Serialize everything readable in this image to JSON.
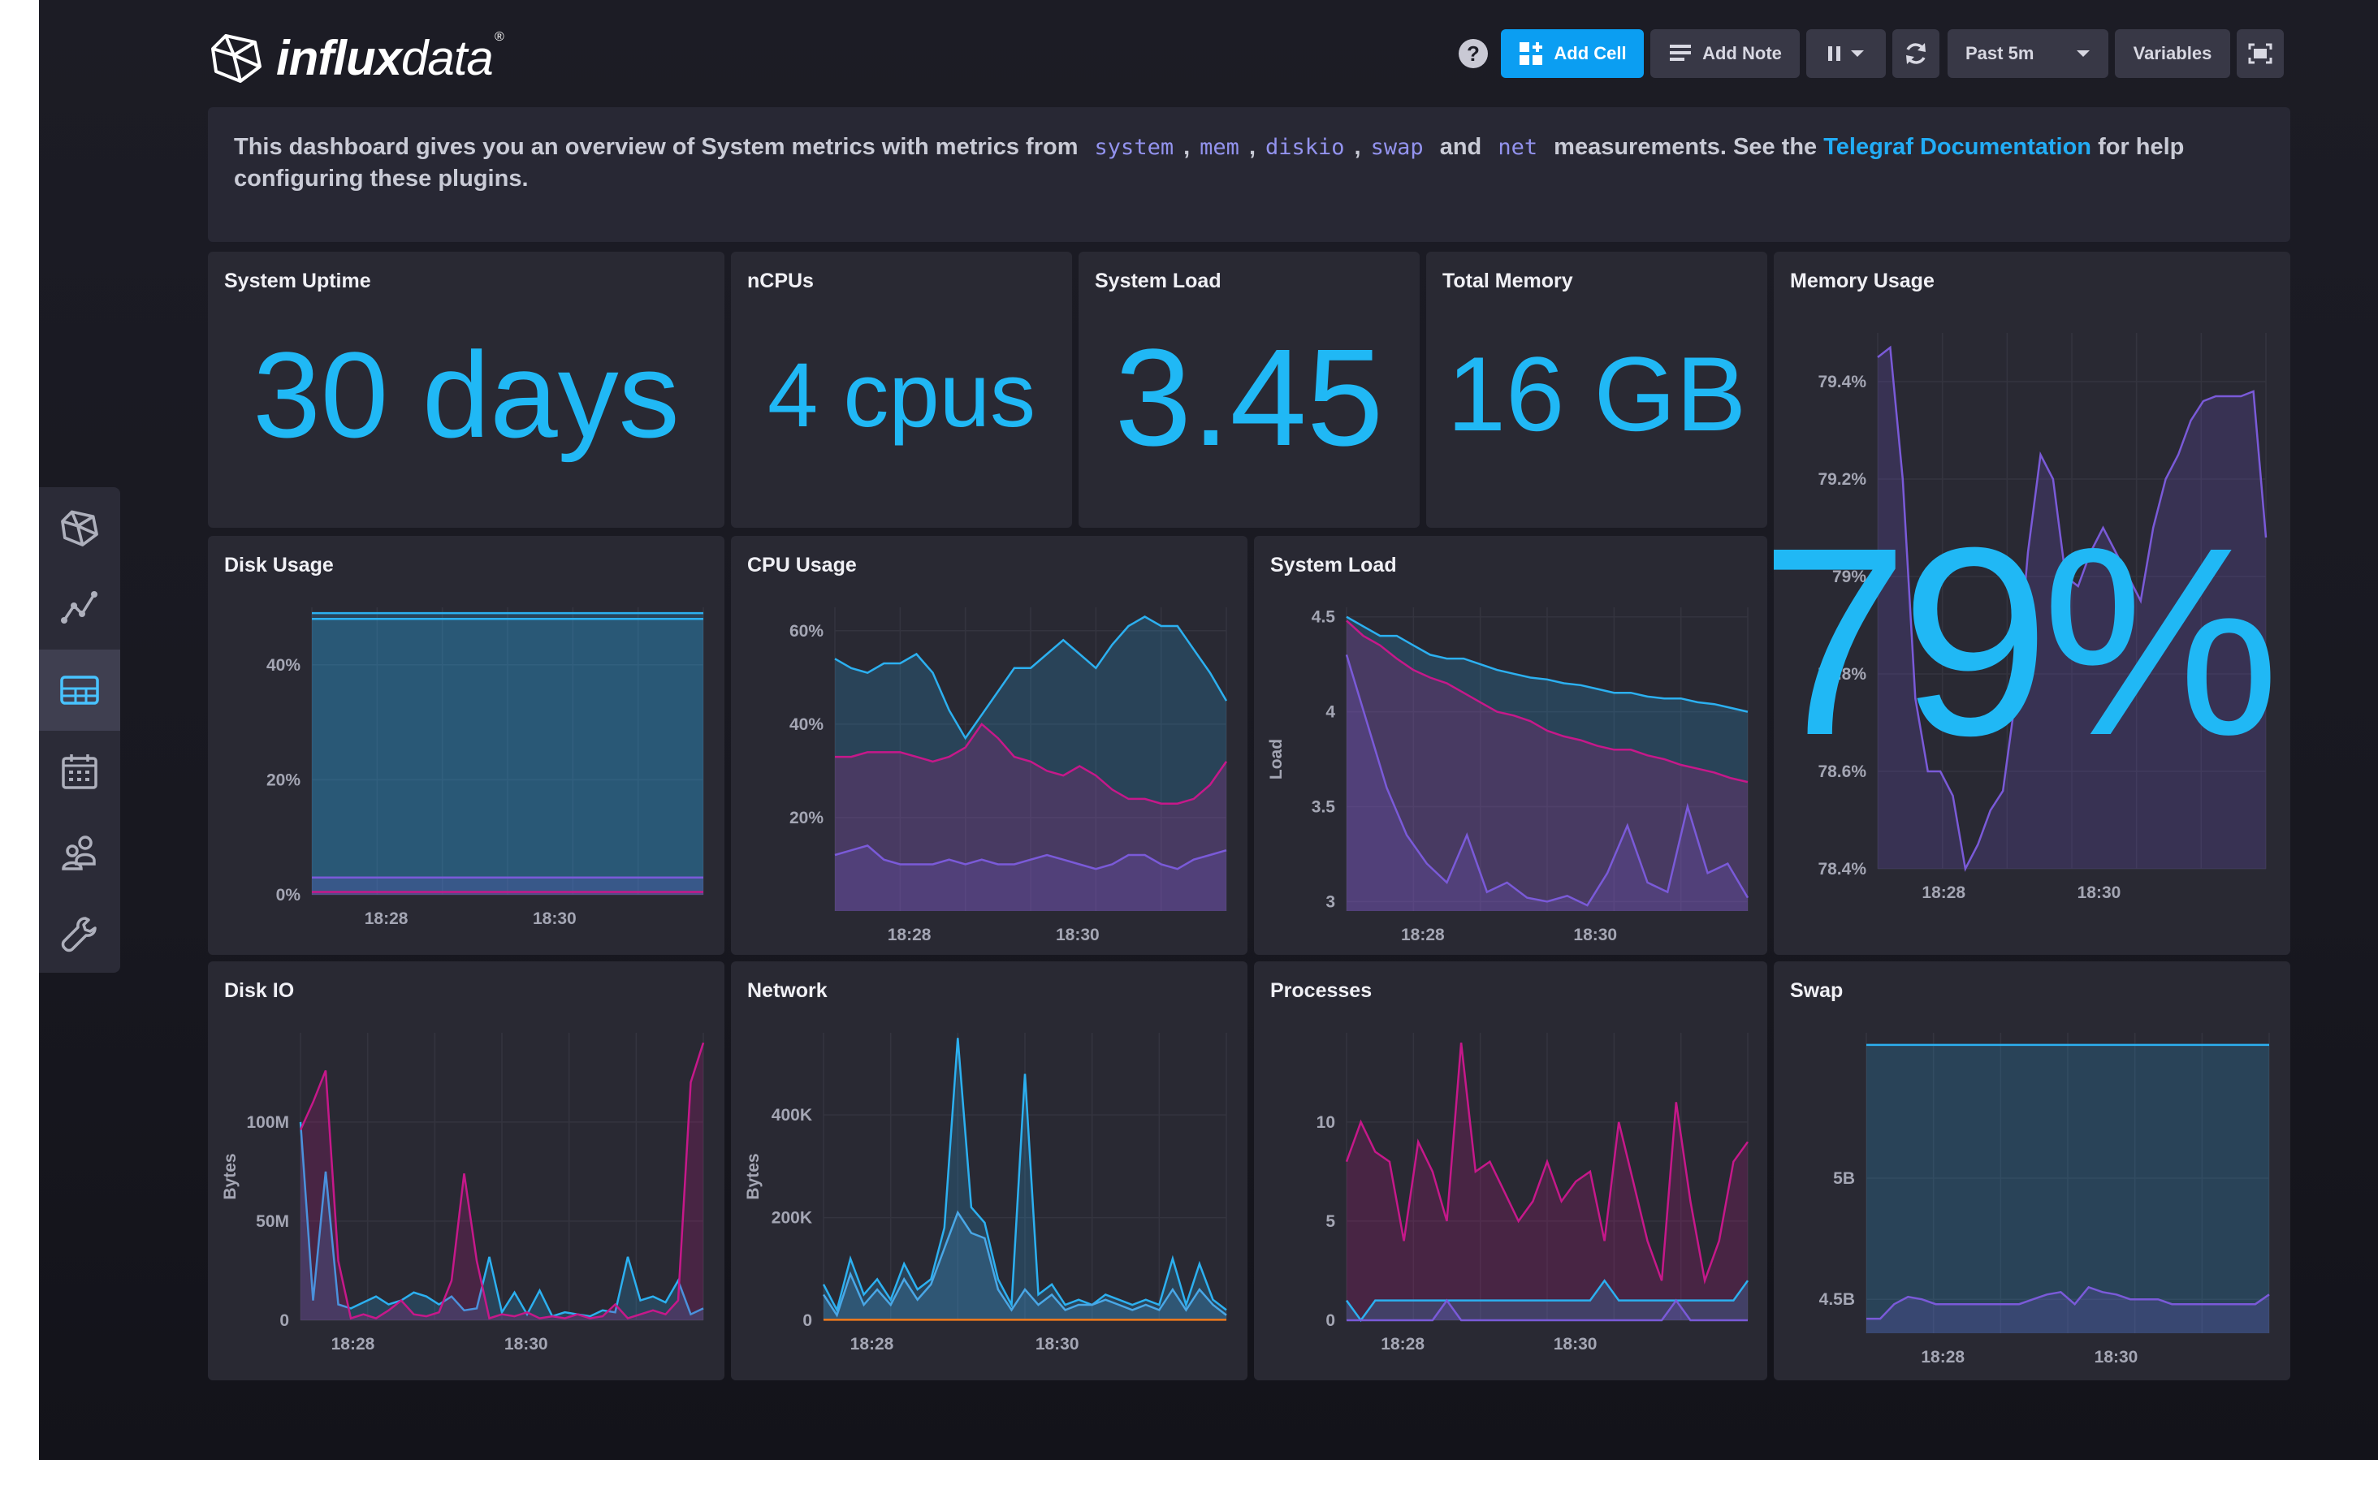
{
  "header": {
    "logo_bold": "influx",
    "logo_light": "data",
    "logo_mark": "®",
    "help_label": "?",
    "add_cell": "Add Cell",
    "add_note": "Add Note",
    "pause_icon": "pause-icon",
    "time_range": "Past 5m",
    "variables": "Variables"
  },
  "sidebar": {
    "items": [
      {
        "name": "logo",
        "icon": "influx-logo-icon"
      },
      {
        "name": "data-explorer",
        "icon": "graph-icon"
      },
      {
        "name": "dashboards",
        "icon": "dashboard-grid-icon",
        "active": true
      },
      {
        "name": "tasks",
        "icon": "calendar-icon"
      },
      {
        "name": "organizations",
        "icon": "users-icon"
      },
      {
        "name": "settings",
        "icon": "wrench-icon"
      }
    ]
  },
  "note": {
    "text_before": "This dashboard gives you an overview of System metrics with metrics from",
    "m1": "system",
    "m2": "mem",
    "m3": "diskio",
    "m4": "swap",
    "and": "and",
    "m5": "net",
    "text_after": "measurements. See the",
    "link": "Telegraf Documentation",
    "text_end": "for help configuring these plugins."
  },
  "cells": {
    "uptime": {
      "title": "System Uptime",
      "value": "30 days"
    },
    "ncpus": {
      "title": "nCPUs",
      "value": "4 cpus"
    },
    "load_stat": {
      "title": "System Load",
      "value": "3.45"
    },
    "memory_total": {
      "title": "Total Memory",
      "value": "16 GB"
    },
    "memory_usage": {
      "title": "Memory Usage",
      "value": "79%"
    },
    "disk_usage": {
      "title": "Disk Usage"
    },
    "cpu_usage": {
      "title": "CPU Usage"
    },
    "system_load": {
      "title": "System Load"
    },
    "disk_io": {
      "title": "Disk IO"
    },
    "network": {
      "title": "Network"
    },
    "processes": {
      "title": "Processes"
    },
    "swap": {
      "title": "Swap"
    }
  },
  "colors": {
    "accent": "#0b9ef2",
    "stat": "#20b8f5",
    "series_blue": "#2cb0f0",
    "series_magenta": "#c6188a",
    "series_purple": "#7a5ad8",
    "series_orange": "#f27a1a"
  },
  "chart_data": [
    {
      "id": "memory_usage",
      "type": "area",
      "title": "Memory Usage",
      "xlabel": "",
      "ylabel": "",
      "ylim": [
        78.4,
        79.5
      ],
      "yticks": [
        "79.4%",
        "79.2%",
        "79%",
        "78.8%",
        "78.6%",
        "78.4%"
      ],
      "ytick_values": [
        79.4,
        79.2,
        79.0,
        78.8,
        78.6,
        78.4
      ],
      "xticks": [
        "18:28",
        "18:30"
      ],
      "xtick_at": [
        0.17,
        0.57
      ],
      "series": [
        {
          "color": "#7a5ad8",
          "values": [
            79.45,
            79.47,
            79.2,
            78.75,
            78.6,
            78.6,
            78.55,
            78.4,
            78.45,
            78.52,
            78.56,
            78.75,
            79.05,
            79.25,
            79.2,
            79.0,
            78.98,
            79.05,
            79.1,
            79.05,
            79.0,
            78.95,
            79.1,
            79.2,
            79.25,
            79.32,
            79.36,
            79.37,
            79.37,
            79.37,
            79.38,
            79.08
          ]
        }
      ]
    },
    {
      "id": "disk_usage",
      "type": "area",
      "title": "Disk Usage",
      "ylim": [
        0,
        50
      ],
      "yticks": [
        "40%",
        "20%",
        "0%"
      ],
      "ytick_values": [
        40,
        20,
        0
      ],
      "xticks": [
        "18:28",
        "18:30"
      ],
      "xtick_at": [
        0.19,
        0.62
      ],
      "series": [
        {
          "color": "#2cb0f0",
          "values": [
            49,
            49
          ]
        },
        {
          "color": "#2cb0f0",
          "values": [
            48,
            48
          ]
        },
        {
          "color": "#7a5ad8",
          "values": [
            3,
            3
          ]
        },
        {
          "color": "#c6188a",
          "values": [
            0.5,
            0.5
          ]
        }
      ]
    },
    {
      "id": "cpu_usage",
      "type": "area",
      "title": "CPU Usage",
      "ylim": [
        0,
        65
      ],
      "yticks": [
        "60%",
        "40%",
        "20%"
      ],
      "ytick_values": [
        60,
        40,
        20
      ],
      "xticks": [
        "18:28",
        "18:30"
      ],
      "xtick_at": [
        0.19,
        0.62
      ],
      "series": [
        {
          "color": "#2cb0f0",
          "values": [
            54,
            52,
            51,
            53,
            53,
            55,
            51,
            43,
            37,
            42,
            47,
            52,
            52,
            55,
            58,
            55,
            52,
            57,
            61,
            63,
            61,
            61,
            56,
            51,
            45
          ]
        },
        {
          "color": "#c6188a",
          "values": [
            33,
            33,
            34,
            34,
            34,
            33,
            32,
            33,
            35,
            40,
            37,
            33,
            32,
            30,
            29,
            31,
            29,
            26,
            24,
            24,
            23,
            23,
            24,
            27,
            32
          ]
        },
        {
          "color": "#7a5ad8",
          "values": [
            12,
            13,
            14,
            11,
            10,
            10,
            10,
            11,
            10,
            11,
            10,
            10,
            11,
            12,
            11,
            10,
            9,
            10,
            12,
            12,
            10,
            9,
            11,
            12,
            13
          ]
        }
      ]
    },
    {
      "id": "system_load",
      "type": "area",
      "title": "System Load",
      "ylabel": "Load",
      "ylim": [
        2.95,
        4.55
      ],
      "yticks": [
        "4.5",
        "4",
        "3.5",
        "3"
      ],
      "ytick_values": [
        4.5,
        4,
        3.5,
        3
      ],
      "xticks": [
        "18:28",
        "18:30"
      ],
      "xtick_at": [
        0.19,
        0.62
      ],
      "series": [
        {
          "color": "#2cb0f0",
          "values": [
            4.5,
            4.45,
            4.4,
            4.4,
            4.35,
            4.3,
            4.28,
            4.28,
            4.25,
            4.22,
            4.2,
            4.18,
            4.17,
            4.15,
            4.14,
            4.12,
            4.1,
            4.1,
            4.08,
            4.07,
            4.07,
            4.05,
            4.04,
            4.02,
            4.0
          ]
        },
        {
          "color": "#c6188a",
          "values": [
            4.48,
            4.4,
            4.35,
            4.28,
            4.22,
            4.18,
            4.15,
            4.1,
            4.05,
            4.0,
            3.98,
            3.95,
            3.9,
            3.87,
            3.85,
            3.82,
            3.8,
            3.8,
            3.77,
            3.75,
            3.72,
            3.7,
            3.68,
            3.65,
            3.63
          ]
        },
        {
          "color": "#7a5ad8",
          "values": [
            4.3,
            3.95,
            3.6,
            3.35,
            3.2,
            3.1,
            3.35,
            3.05,
            3.1,
            3.02,
            3.0,
            3.03,
            2.98,
            3.15,
            3.4,
            3.1,
            3.05,
            3.5,
            3.15,
            3.2,
            3.02
          ]
        }
      ]
    },
    {
      "id": "disk_io",
      "type": "area",
      "title": "Disk IO",
      "ylabel": "Bytes",
      "ylim": [
        0,
        145000000
      ],
      "yticks": [
        "100M",
        "50M",
        "0"
      ],
      "ytick_values": [
        100000000,
        50000000,
        0
      ],
      "xticks": [
        "18:28",
        "18:30"
      ],
      "xtick_at": [
        0.13,
        0.56
      ],
      "series": [
        {
          "color": "#2cb0f0",
          "values": [
            100000000,
            10000000,
            75000000,
            8000000,
            6000000,
            9000000,
            12000000,
            8000000,
            10000000,
            14000000,
            12000000,
            8000000,
            12000000,
            5000000,
            6000000,
            32000000,
            4000000,
            14000000,
            3000000,
            15000000,
            2000000,
            4000000,
            3000000,
            2000000,
            5000000,
            4000000,
            32000000,
            10000000,
            12000000,
            9000000,
            20000000,
            3000000,
            6000000
          ]
        },
        {
          "color": "#c6188a",
          "values": [
            96000000,
            110000000,
            126000000,
            30000000,
            1000000,
            3000000,
            1000000,
            5000000,
            10000000,
            3000000,
            2000000,
            4000000,
            20000000,
            74000000,
            30000000,
            1000000,
            3000000,
            2000000,
            4000000,
            1000000,
            2000000,
            1000000,
            3000000,
            1000000,
            2000000,
            8000000,
            1000000,
            3000000,
            5000000,
            3000000,
            10000000,
            120000000,
            140000000
          ]
        }
      ]
    },
    {
      "id": "network",
      "type": "area",
      "title": "Network",
      "ylabel": "Bytes",
      "ylim": [
        0,
        560000
      ],
      "yticks": [
        "400K",
        "200K",
        "0"
      ],
      "ytick_values": [
        400000,
        200000,
        0
      ],
      "xticks": [
        "18:28",
        "18:30"
      ],
      "xtick_at": [
        0.12,
        0.58
      ],
      "series": [
        {
          "color": "#2cb0f0",
          "values": [
            70000,
            20000,
            120000,
            50000,
            80000,
            40000,
            110000,
            60000,
            80000,
            180000,
            550000,
            220000,
            190000,
            80000,
            30000,
            480000,
            50000,
            70000,
            30000,
            40000,
            30000,
            50000,
            40000,
            30000,
            40000,
            30000,
            120000,
            30000,
            110000,
            40000,
            20000
          ]
        },
        {
          "color": "#49a7e6",
          "values": [
            50000,
            10000,
            90000,
            30000,
            60000,
            30000,
            80000,
            40000,
            70000,
            140000,
            210000,
            170000,
            160000,
            60000,
            20000,
            60000,
            30000,
            50000,
            20000,
            30000,
            30000,
            40000,
            30000,
            20000,
            30000,
            20000,
            60000,
            20000,
            60000,
            30000,
            10000
          ]
        },
        {
          "color": "#f27a1a",
          "values": [
            1000,
            1000
          ]
        }
      ]
    },
    {
      "id": "processes",
      "type": "area",
      "title": "Processes",
      "ylim": [
        0,
        14.5
      ],
      "yticks": [
        "10",
        "5",
        "0"
      ],
      "ytick_values": [
        10,
        5,
        0
      ],
      "xticks": [
        "18:28",
        "18:30"
      ],
      "xtick_at": [
        0.14,
        0.57
      ],
      "series": [
        {
          "color": "#c6188a",
          "values": [
            8,
            10,
            8.5,
            8,
            4,
            9,
            7.5,
            5,
            14,
            7.5,
            8,
            6.5,
            5,
            6,
            8,
            6,
            7,
            7.5,
            4,
            10,
            7,
            4,
            2,
            11,
            6,
            2,
            4,
            8,
            9
          ]
        },
        {
          "color": "#2cb0f0",
          "values": [
            1,
            0,
            1,
            1,
            1,
            1,
            1,
            1,
            1,
            1,
            1,
            1,
            1,
            1,
            1,
            1,
            1,
            1,
            2,
            1,
            1,
            1,
            1,
            1,
            1,
            1,
            1,
            1,
            2
          ]
        },
        {
          "color": "#7a5ad8",
          "values": [
            0,
            0,
            0,
            0,
            0,
            0,
            0,
            1,
            0,
            0,
            0,
            0,
            0,
            0,
            0,
            0,
            0,
            0,
            0,
            0,
            0,
            0,
            0,
            1,
            0,
            0,
            0,
            0,
            0
          ]
        }
      ]
    },
    {
      "id": "swap",
      "type": "area",
      "title": "Swap",
      "ylim": [
        4.36,
        5.6
      ],
      "yticks": [
        "5B",
        "4.5B"
      ],
      "ytick_values": [
        5.0,
        4.5
      ],
      "xticks": [
        "18:28",
        "18:30"
      ],
      "xtick_at": [
        0.19,
        0.62
      ],
      "series": [
        {
          "color": "#2cb0f0",
          "values": [
            5.55,
            5.55
          ]
        },
        {
          "color": "#7a5ad8",
          "values": [
            4.42,
            4.42,
            4.48,
            4.51,
            4.5,
            4.48,
            4.48,
            4.48,
            4.48,
            4.48,
            4.48,
            4.48,
            4.5,
            4.52,
            4.53,
            4.48,
            4.55,
            4.53,
            4.52,
            4.5,
            4.5,
            4.5,
            4.48,
            4.48,
            4.48,
            4.48,
            4.48,
            4.48,
            4.48,
            4.52
          ]
        }
      ]
    }
  ]
}
